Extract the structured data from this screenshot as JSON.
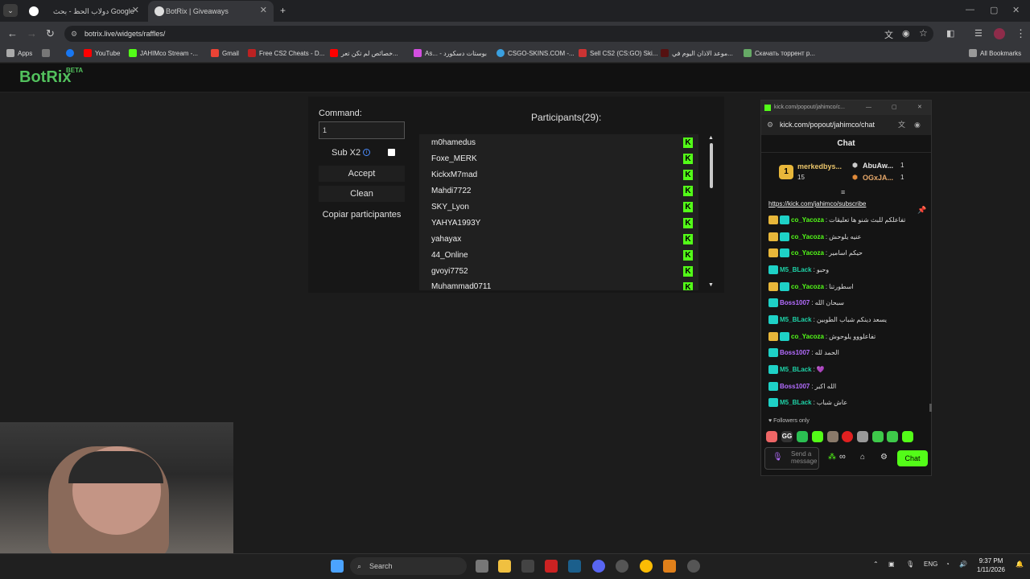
{
  "browser": {
    "tabs": [
      {
        "label": "دولاب الحظ - بحث Google"
      },
      {
        "label": "BotRix | Giveaways"
      }
    ],
    "url": "botrix.live/widgets/raffles/",
    "bookmarks": [
      "Apps",
      "YouTube",
      "JAHIMco Stream -...",
      "Gmail",
      "Free CS2 Cheats - D...",
      "خصائص لم تكن تعر...",
      "As... - بوستات دسكورد",
      "CSGO-SKINS.COM -...",
      "Sell CS2 (CS:GO) Ski...",
      "موعد الاذان اليوم في...",
      "Скачать торрент р...",
      "All Bookmarks"
    ]
  },
  "brand": {
    "name": "BotRix",
    "badge": "BETA"
  },
  "raffle": {
    "command_label": "Command:",
    "command_value": "1",
    "sub_label": "Sub X2",
    "sub_info": "i",
    "accept": "Accept",
    "clean": "Clean",
    "copy": "Copiar participantes",
    "participants_title": "Participants(29):",
    "participants": [
      "m0hamedus",
      "Foxe_MERK",
      "KickxM7mad",
      "Mahdi7722",
      "SKY_Lyon",
      "YAHYA1993Y",
      "yahayax",
      "44_Online",
      "gvoyi7752",
      "Muhammad0711"
    ],
    "badge": "K"
  },
  "chat": {
    "window_title": "kick.com/popout/jahimco/c...",
    "url": "kick.com/popout/jahimco/chat",
    "header": "Chat",
    "leaders": {
      "first_rank": "1",
      "first_name": "merkedbys...",
      "first_count": "15",
      "second_name": "AbuAw...",
      "second_count": "1",
      "third_name": "OGxJA...",
      "third_count": "1"
    },
    "subscribe_link": "https://kick.com/jahimco/subscribe",
    "messages": [
      {
        "user": "co_Yacoza",
        "text": "تفاعلكم للبث شنو ها تعليقات",
        "color": "#53fc18",
        "crown": true
      },
      {
        "user": "co_Yacoza",
        "text": "عنيه يلوحش",
        "color": "#53fc18",
        "crown": true
      },
      {
        "user": "co_Yacoza",
        "text": "حيكم اسامير",
        "color": "#53fc18",
        "crown": true
      },
      {
        "user": "M5_BLack",
        "text": "وحبو",
        "color": "#1ed1a6",
        "crown": false
      },
      {
        "user": "co_Yacoza",
        "text": "اسطورتنا",
        "color": "#53fc18",
        "crown": true
      },
      {
        "user": "Boss1007",
        "text": "سبحان الله",
        "color": "#b36cff",
        "crown": false
      },
      {
        "user": "M5_BLack",
        "text": "يسعد دينكم شباب الطوبين",
        "color": "#1ed1a6",
        "crown": false
      },
      {
        "user": "co_Yacoza",
        "text": "تفاعلووو يلوحوش",
        "color": "#53fc18",
        "crown": true
      },
      {
        "user": "Boss1007",
        "text": "الحمد لله",
        "color": "#b36cff",
        "crown": false
      },
      {
        "user": "M5_BLack",
        "text": "💜",
        "color": "#1ed1a6",
        "crown": false
      },
      {
        "user": "Boss1007",
        "text": "الله اكبر",
        "color": "#b36cff",
        "crown": false
      },
      {
        "user": "M5_BLack",
        "text": "عاش شباب",
        "color": "#1ed1a6",
        "crown": false
      }
    ],
    "followers_only": "Followers only",
    "input_placeholder": "Send a message",
    "send": "Chat"
  },
  "taskbar": {
    "search": "Search",
    "lang": "ENG",
    "time": "9:37 PM",
    "date": "1/11/2026"
  }
}
